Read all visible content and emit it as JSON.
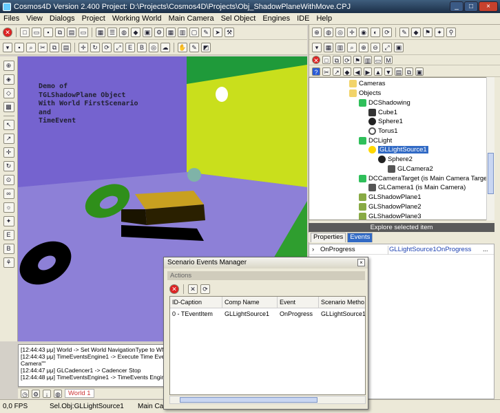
{
  "window": {
    "title": "Cosmos4D Version 2.400   Project: D:\\Projects\\Cosmos4D\\Projects\\Obj_ShadowPlaneWithMove.CPJ"
  },
  "menu": [
    "Files",
    "View",
    "Dialogs",
    "Project",
    "Working World",
    "Main Camera",
    "Sel Object",
    "Engines",
    "IDE",
    "Help"
  ],
  "viewport": {
    "caption_lines": [
      "Demo of",
      "TGLShadowPlane Object",
      "With World FirstScenario",
      "and",
      "TimeEvent"
    ]
  },
  "log": {
    "lines": [
      "[12:44:43 μμ] World -> Set World NavigationType to WNT",
      "[12:44:43 μμ] TimeEventsEngine1 -> Execute Time Event",
      "Camera\"\"",
      "[12:44:47 μμ] GLCadencer1 -> Cadencer Stop",
      "[12:44:48 μμ] TimeEventsEngine1 -> TimeEvents Engine S"
    ]
  },
  "bottom_tab": "World 1",
  "status": {
    "fps": "0,0 FPS",
    "selected": "Sel.Obj:GLLightSource1",
    "main_camera": "Main Ca"
  },
  "tree": [
    {
      "label": "Cameras",
      "icon": "folder-icon",
      "depth": 3
    },
    {
      "label": "Objects",
      "icon": "folder-icon",
      "depth": 3
    },
    {
      "label": "DCShadowing",
      "icon": "dummy-cube-icon",
      "depth": 4
    },
    {
      "label": "Cube1",
      "icon": "cube-icon",
      "depth": 5
    },
    {
      "label": "Sphere1",
      "icon": "sphere-icon",
      "depth": 5
    },
    {
      "label": "Torus1",
      "icon": "torus-icon",
      "depth": 5
    },
    {
      "label": "DCLight",
      "icon": "dummy-cube-icon",
      "depth": 4
    },
    {
      "label": "GLLightSource1",
      "icon": "light-bulb-icon",
      "depth": 5,
      "selected": true
    },
    {
      "label": "Sphere2",
      "icon": "sphere-icon",
      "depth": 6
    },
    {
      "label": "GLCamera2",
      "icon": "camera-icon",
      "depth": 7
    },
    {
      "label": "DCCameraTarget  (is Main Camera Target)",
      "icon": "dummy-cube-icon",
      "depth": 4
    },
    {
      "label": "GLCamera1  (is Main Camera)",
      "icon": "camera-icon",
      "depth": 5
    },
    {
      "label": "GLShadowPlane1",
      "icon": "shadow-plane-icon",
      "depth": 4
    },
    {
      "label": "GLShadowPlane2",
      "icon": "shadow-plane-icon",
      "depth": 4
    },
    {
      "label": "GLShadowPlane3",
      "icon": "shadow-plane-icon",
      "depth": 4
    }
  ],
  "explore_label": "Explore selected item",
  "prop_tabs": [
    "Properties",
    "Events"
  ],
  "event_row": {
    "name": "OnProgress",
    "value": "GLLightSource1OnProgress",
    "btn": "..."
  },
  "dialog": {
    "title": "Scenario Events Manager",
    "close": "×",
    "actions_label": "Actions",
    "columns": [
      "ID-Caption",
      "Comp Name",
      "Event",
      "Scenario Metho..."
    ],
    "rows": [
      [
        "0 - TEventItem",
        "GLLightSource1",
        "OnProgress",
        "GLLightSource1..."
      ]
    ]
  },
  "colors": {
    "back_wall": "#7b6dd3",
    "right_wall": "#c8e01a",
    "floor": "#8f82d6",
    "left_green": "#2f9e2f"
  }
}
